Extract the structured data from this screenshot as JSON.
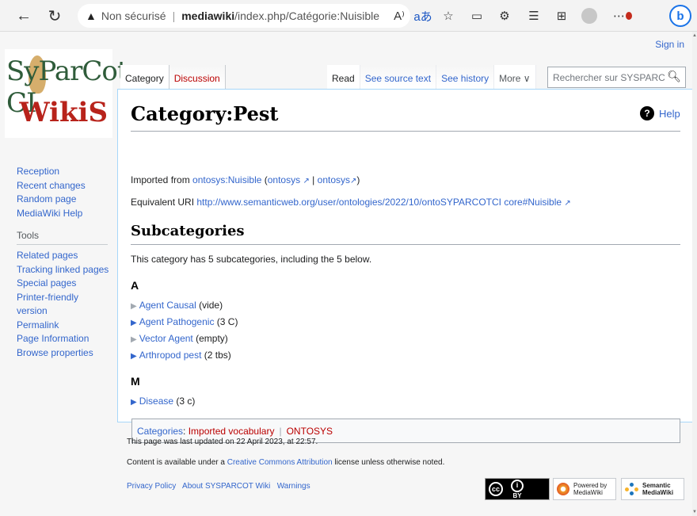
{
  "browser": {
    "security_warning": "Non sécurisé",
    "url_domain": "mediawiki",
    "url_path": "/index.php/Catégorie:Nuisible",
    "read_aloud_glyph": "A⁾",
    "translate_glyph": "aあ"
  },
  "header": {
    "sign_in": "Sign in"
  },
  "logo": {
    "line1": "SyParCot-CI",
    "line2": "WikiS"
  },
  "tabs": {
    "category": "Category",
    "discussion": "Discussion",
    "read": "Read",
    "view_source": "See source text",
    "history": "See history",
    "more": "More ∨"
  },
  "search": {
    "placeholder": "Rechercher sur SYSPARCOT"
  },
  "sidebar": {
    "nav": [
      "Reception",
      "Recent changes",
      "Random page",
      "MediaWiki Help"
    ],
    "tools_heading": "Tools",
    "tools": [
      "Related pages",
      "Tracking linked pages",
      "Special pages",
      "Printer-friendly version",
      "Permalink",
      "Page Information",
      "Browse properties"
    ]
  },
  "page": {
    "title": "Category:Pest",
    "help": "Help",
    "imported_prefix": "Imported from ",
    "imported_link": "ontosys:Nuisible",
    "imported_open": " (",
    "imported_src1": "ontosys",
    "imported_sep": " | ",
    "imported_src2": "ontosys",
    "imported_close": ")",
    "uri_prefix": "Equivalent URI ",
    "uri": "http://www.semanticweb.org/user/ontologies/2022/10/ontoSYPARCOTCI core#Nuisible",
    "subcategories_heading": "Subcategories",
    "subcategories_intro": "This category has 5 subcategories, including the 5 below."
  },
  "groups": [
    {
      "letter": "A",
      "items": [
        {
          "name": "Agent Causal",
          "count": " (vide)"
        },
        {
          "name": "Agent Pathogenic",
          "count": " (3 C)"
        },
        {
          "name": "Vector Agent",
          "count": " (empty)"
        },
        {
          "name": "Arthropod pest",
          "count": " (2 tbs)"
        }
      ]
    },
    {
      "letter": "M",
      "items": [
        {
          "name": "Disease",
          "count": " (3 c)"
        }
      ]
    }
  ],
  "categories": {
    "label": "Categories",
    "colon": ":",
    "items": [
      "Imported vocabulary",
      "ONTOSYS"
    ]
  },
  "footer": {
    "last_updated": "This page was last updated on 22 April 2023, at 22:57.",
    "license_prefix": "Content is available under a ",
    "license_link": "Creative Commons Attribution",
    "license_suffix": " license unless otherwise noted.",
    "links": [
      "Privacy Policy",
      "About SYSPARCOT Wiki",
      "Warnings"
    ],
    "badge_mw_line1": "Powered by",
    "badge_mw_line2": "MediaWiki",
    "badge_smw_line1": "Semantic",
    "badge_smw_line2": "MediaWiki",
    "badge_cc_by": "BY"
  }
}
